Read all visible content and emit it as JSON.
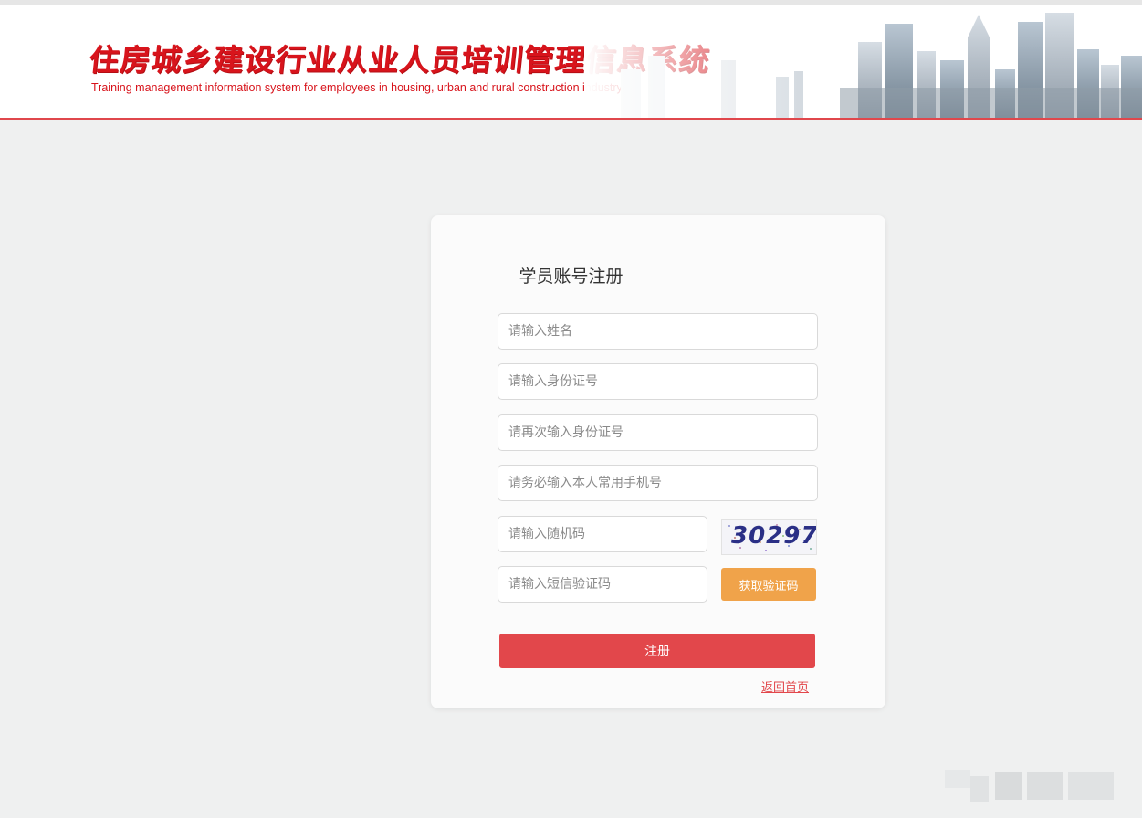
{
  "header": {
    "title": "住房城乡建设行业从业人员培训管理信息系统",
    "subtitle": "Training management information system for employees in housing, urban and rural construction industry"
  },
  "form": {
    "title": "学员账号注册",
    "name_placeholder": "请输入姓名",
    "id_placeholder": "请输入身份证号",
    "id_confirm_placeholder": "请再次输入身份证号",
    "phone_placeholder": "请务必输入本人常用手机号",
    "captcha_placeholder": "请输入随机码",
    "captcha_code": "30297",
    "sms_placeholder": "请输入短信验证码",
    "sms_button": "获取验证码",
    "submit_button": "注册",
    "back_link": "返回首页"
  },
  "colors": {
    "brand_red": "#d8141c",
    "button_red": "#e2474b",
    "sms_orange": "#f0a34a",
    "page_bg": "#eff0f0"
  }
}
